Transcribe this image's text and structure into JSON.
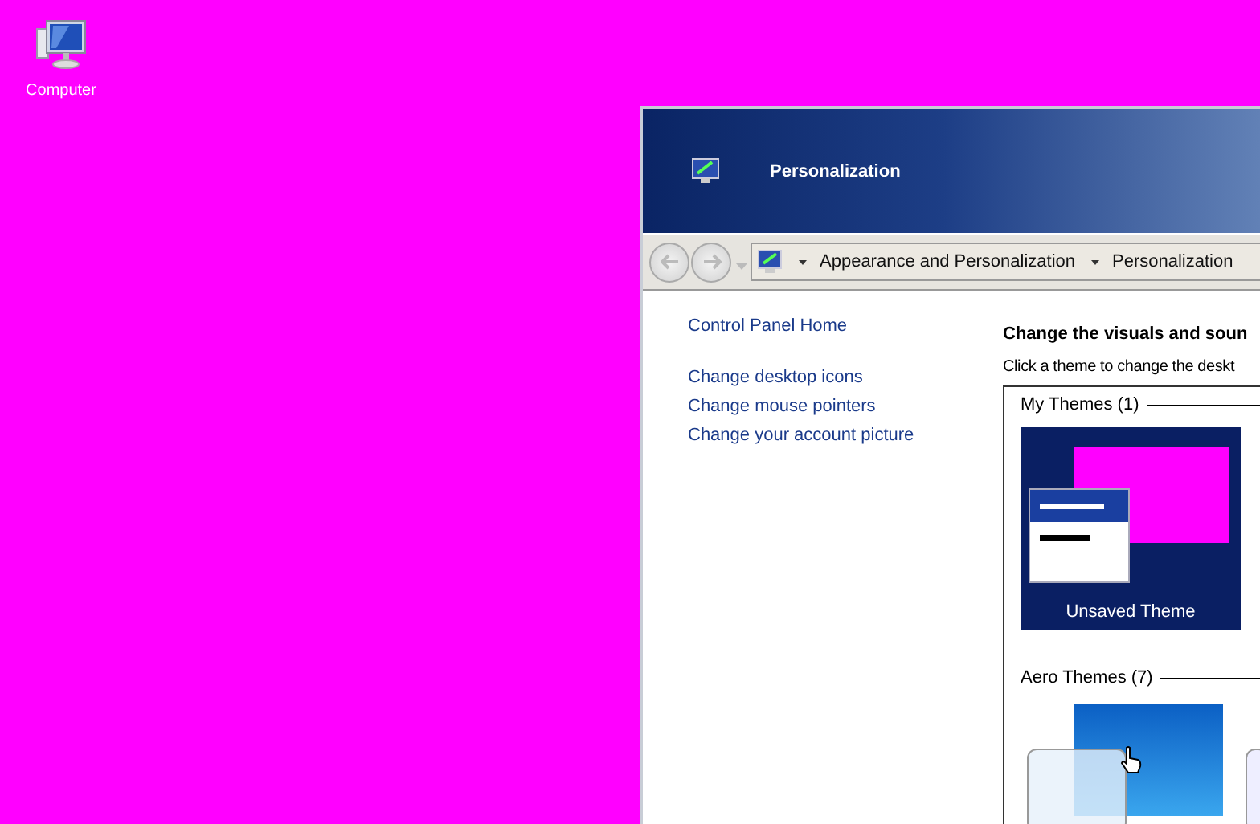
{
  "desktop_icons": [
    {
      "label": "Computer"
    }
  ],
  "window": {
    "title": "Personalization"
  },
  "address_bar": {
    "crumbs": [
      "Appearance and Personalization",
      "Personalization"
    ]
  },
  "sidebar": {
    "items": [
      "Control Panel Home",
      "Change desktop icons",
      "Change mouse pointers",
      "Change your account picture"
    ]
  },
  "main": {
    "heading": "Change the visuals and soun",
    "description": "Click a theme to change the deskt",
    "groups": [
      {
        "title": "My Themes (1)",
        "themes": [
          {
            "label": "Unsaved Theme"
          }
        ]
      },
      {
        "title": "Aero Themes (7)"
      }
    ]
  }
}
